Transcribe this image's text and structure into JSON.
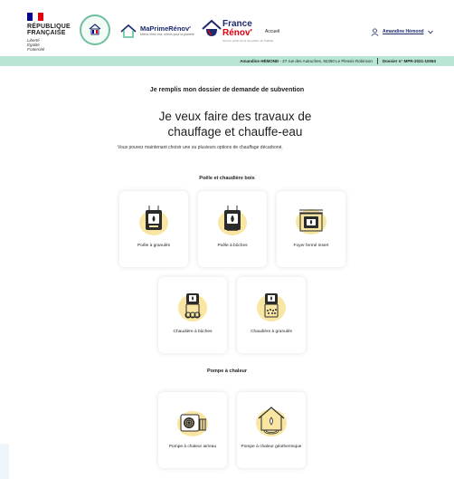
{
  "header": {
    "republic": {
      "line1": "RÉPUBLIQUE",
      "line2": "FRANÇAISE",
      "motto": [
        "Liberté",
        "Égalité",
        "Fraternité"
      ]
    },
    "seal_text": "FRANCE RELANCE",
    "mpr": {
      "title": "MaPrimeRénov'",
      "subtitle": "Mieux chez moi, mieux pour la planète"
    },
    "frr": {
      "line1": "France",
      "line2": "Rénov'",
      "subtitle": "Service public de la rénovation de l'habitat"
    },
    "nav_home": "Accueil",
    "user_name": "Amandine Hémond"
  },
  "info_bar": {
    "name": "Amandine HÉMOND",
    "address": " - 27 rue des Autruches, 92350 Le Plessis Robinson",
    "dossier_label": "Dossier n°",
    "dossier_number": "MPR-2021-10063"
  },
  "page": {
    "heading": "Je remplis mon dossier de demande de subvention",
    "title_line1": "Je veux faire des travaux de",
    "title_line2": "chauffage et chauffe-eau",
    "intro": "Vous pouvez maintenant choisir une ou plusieurs options de chauffage décarboné."
  },
  "sections": [
    {
      "title": "Poêle et chaudière bois",
      "options": [
        {
          "label": "Poêle à granulés",
          "icon": "pellet-stove-icon"
        },
        {
          "label": "Poêle à bûches",
          "icon": "log-stove-icon"
        },
        {
          "label": "Foyer fermé insert",
          "icon": "insert-fireplace-icon"
        },
        {
          "label": "Chaudière à bûches",
          "icon": "log-boiler-icon"
        },
        {
          "label": "Chaudière à granulés",
          "icon": "pellet-boiler-icon"
        }
      ]
    },
    {
      "title": "Pompe à chaleur",
      "options": [
        {
          "label": "Pompe à chaleur air/eau",
          "icon": "air-water-heat-pump-icon"
        },
        {
          "label": "Pompe à chaleur géothermique",
          "icon": "geothermal-heat-pump-icon"
        }
      ]
    }
  ],
  "colors": {
    "accent_mint": "#b8e5d4",
    "illustration_yellow": "#f8e6a2",
    "navy": "#1d2a6e",
    "france_blue": "#000091",
    "france_red": "#e1000f"
  }
}
